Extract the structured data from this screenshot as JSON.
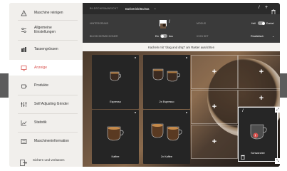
{
  "sidebar": {
    "items": [
      {
        "label": "Maschine reinigen",
        "icon": "cleaning-icon"
      },
      {
        "label": "Allgemeine\nEinstellungen",
        "icon": "settings-icon"
      },
      {
        "label": "Tassengrössen",
        "icon": "cup-size-icon"
      },
      {
        "label": "Anzeige",
        "icon": "display-icon",
        "active": true
      },
      {
        "label": "Produkte",
        "icon": "products-icon"
      },
      {
        "label": "Self Adjusting Grinder",
        "icon": "grinder-icon"
      },
      {
        "label": "Statistik",
        "icon": "statistics-icon"
      },
      {
        "label": "Maschineninformation",
        "icon": "info-icon"
      }
    ],
    "save_label": "Sichern und verlassen"
  },
  "topbar": {
    "breadcrumb_section": "BILDSCHIRMANSICHT",
    "breadcrumb_current": "Barbetrieb/Barista",
    "breadcrumb_chevron": "⌄",
    "edit_icon": "/",
    "add_icon": "+",
    "delete_icon": "🗑"
  },
  "settings": {
    "background_label": "HINTERGRUND",
    "background_edit": "/",
    "mode_label": "MODUS",
    "mode_left": "Hell",
    "mode_right": "Dunkel",
    "tile_labels_label": "BILDSCHIRMSCHONER",
    "tile_labels_left": "Ein",
    "tile_labels_right": "Aus",
    "icon_set_label": "ICON SET",
    "icon_set_value": "Realistisch",
    "icon_set_chevron": "⌄"
  },
  "hint": "Kacheln mit \"drag and drop\" am Raster ausrichten",
  "tiles": [
    {
      "label": "Espresso"
    },
    {
      "label": "2x Espresso"
    },
    {
      "label": "Kaffee"
    },
    {
      "label": "2x Kaffee"
    }
  ],
  "empty_slot_label": "+",
  "selected_tile": {
    "label": "Schwarztee",
    "pencil_icon": "/",
    "trash_icon": "🗑",
    "expand_icon": "⤢",
    "shrink_icon": "⤡"
  },
  "colors": {
    "accent": "#d9534f",
    "topbar": "#2b2b2b",
    "settings": "#3a3a3a",
    "sidebar": "#f1efec"
  }
}
